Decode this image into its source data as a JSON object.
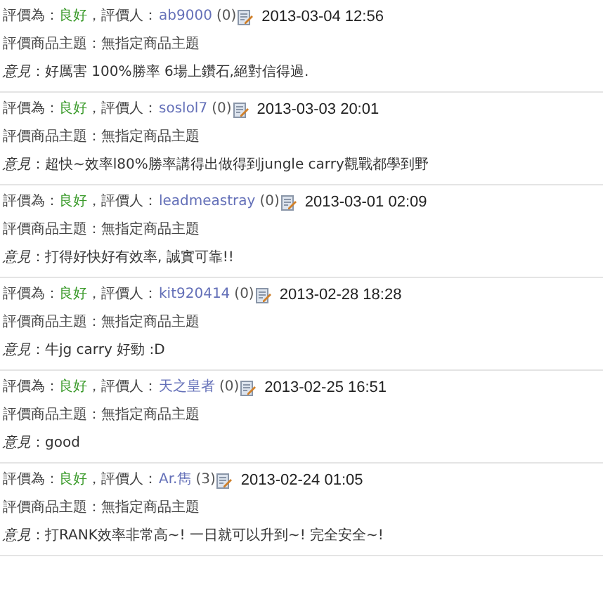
{
  "reviews": [
    {
      "rating_label": "評價為：",
      "rating": "良好",
      "rater_label": "，評價人：",
      "rater": "ab9000",
      "count": "(0)",
      "date": "2013-03-04 12:56",
      "subject": "評價商品主題：無指定商品主題",
      "opinion": "*意見*：好厲害 100%勝率 6場上鑽石,絕對信得過."
    },
    {
      "rating_label": "評價為：",
      "rating": "良好",
      "rater_label": "，評價人：",
      "rater": "soslol7",
      "count": "(0)",
      "date": "2013-03-03 20:01",
      "subject": "評價商品主題：無指定商品主題",
      "opinion": "*意見*：超快~效率l80%勝率講得出做得到jungle carry觀戰都學到野"
    },
    {
      "rating_label": "評價為：",
      "rating": "良好",
      "rater_label": "，評價人：",
      "rater": "leadmeastray",
      "count": "(0)",
      "date": "2013-03-01 02:09",
      "subject": "評價商品主題：無指定商品主題",
      "opinion": "*意見*：打得好快好有效率, 誠實可靠!!"
    },
    {
      "rating_label": "評價為：",
      "rating": "良好",
      "rater_label": "，評價人：",
      "rater": "kit920414",
      "count": "(0)",
      "date": "2013-02-28 18:28",
      "subject": "評價商品主題：無指定商品主題",
      "opinion": "*意見*：牛jg carry 好勁 :D"
    },
    {
      "rating_label": "評價為：",
      "rating": "良好",
      "rater_label": "，評價人：",
      "rater": "天之皇者",
      "count": "(0)",
      "date": "2013-02-25 16:51",
      "subject": "評價商品主題：無指定商品主題",
      "opinion": "*意見*：good"
    },
    {
      "rating_label": "評價為：",
      "rating": "良好",
      "rater_label": "，評價人：",
      "rater": "Ar.雋",
      "count": "(3)",
      "date": "2013-02-24 01:05",
      "subject": "評價商品主題：無指定商品主題",
      "opinion": "*意見*：打RANK效率非常高~! 一日就可以升到~! 完全安全~!"
    }
  ]
}
